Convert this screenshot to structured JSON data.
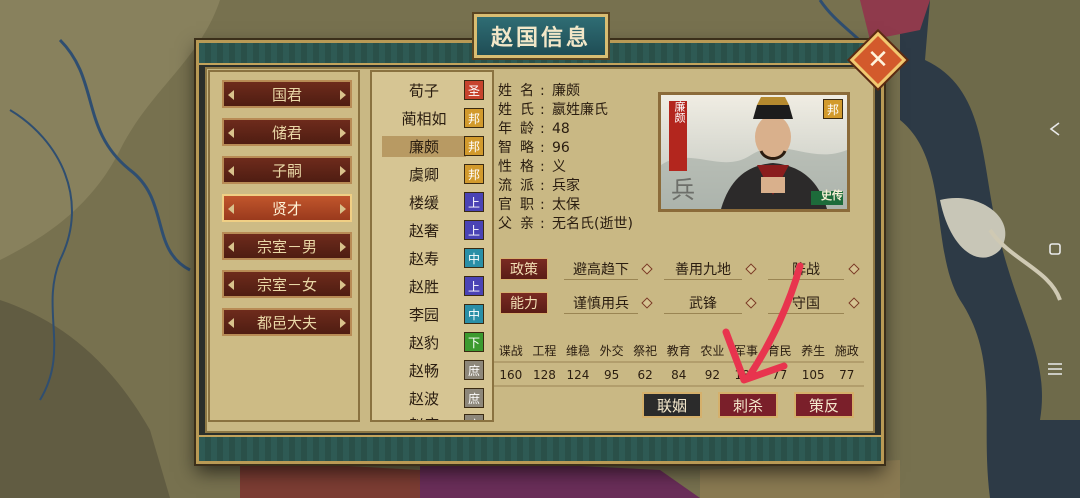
{
  "dialog": {
    "title": "赵国信息",
    "close_symbol": "✕"
  },
  "categories": [
    {
      "label": "国君",
      "active": false
    },
    {
      "label": "储君",
      "active": false
    },
    {
      "label": "子嗣",
      "active": false
    },
    {
      "label": "贤才",
      "active": true
    },
    {
      "label": "宗室－男",
      "active": false
    },
    {
      "label": "宗室－女",
      "active": false
    },
    {
      "label": "都邑大夫",
      "active": false
    }
  ],
  "persons": [
    {
      "name": "荀子",
      "tag": "圣",
      "tag_color": "#c7432d"
    },
    {
      "name": "蔺相如",
      "tag": "邦",
      "tag_color": "#d29a2c"
    },
    {
      "name": "廉颇",
      "tag": "邦",
      "tag_color": "#d29a2c",
      "selected": true
    },
    {
      "name": "虞卿",
      "tag": "邦",
      "tag_color": "#d29a2c"
    },
    {
      "name": "楼缓",
      "tag": "上",
      "tag_color": "#4a43b5"
    },
    {
      "name": "赵奢",
      "tag": "上",
      "tag_color": "#4a43b5"
    },
    {
      "name": "赵寿",
      "tag": "中",
      "tag_color": "#2a8fa7"
    },
    {
      "name": "赵胜",
      "tag": "上",
      "tag_color": "#4a43b5"
    },
    {
      "name": "李园",
      "tag": "中",
      "tag_color": "#2a8fa7"
    },
    {
      "name": "赵豹",
      "tag": "下",
      "tag_color": "#3c9a2f"
    },
    {
      "name": "赵畅",
      "tag": "庶",
      "tag_color": "#8d877a"
    },
    {
      "name": "赵波",
      "tag": "庶",
      "tag_color": "#8d877a"
    },
    {
      "name": "赵庶",
      "tag": "庶",
      "tag_color": "#8d877a"
    }
  ],
  "info": [
    {
      "key": "姓名",
      "value": "廉颇"
    },
    {
      "key": "姓氏",
      "value": "嬴姓廉氏"
    },
    {
      "key": "年龄",
      "value": "48"
    },
    {
      "key": "智略",
      "value": "96"
    },
    {
      "key": "性格",
      "value": "义"
    },
    {
      "key": "流派",
      "value": "兵家"
    },
    {
      "key": "官职",
      "value": "太保"
    },
    {
      "key": "父亲",
      "value": "无名氏(逝世)"
    }
  ],
  "portrait": {
    "side_name": "廉颇",
    "badge": "邦",
    "corner_char": "兵",
    "ribbon": "史传"
  },
  "skills": {
    "policy_label": "政策",
    "ability_label": "能力",
    "policy": [
      "避高趋下",
      "善用九地",
      "阵战"
    ],
    "ability": [
      "谨慎用兵",
      "武锋",
      "守国"
    ]
  },
  "stats": {
    "headers": [
      "谍战",
      "工程",
      "维稳",
      "外交",
      "祭祀",
      "教育",
      "农业",
      "军事",
      "育民",
      "养生",
      "施政"
    ],
    "values": [
      "160",
      "128",
      "124",
      "95",
      "62",
      "84",
      "92",
      "189",
      "77",
      "105",
      "77"
    ]
  },
  "actions": [
    {
      "label": "联姻",
      "color": "#2b2b2b"
    },
    {
      "label": "刺杀",
      "color": "#7a1f2a"
    },
    {
      "label": "策反",
      "color": "#7a1f2a"
    }
  ],
  "colors": {
    "accent_red": "#e8344e",
    "panel": "#c9b884",
    "frame_gold": "#b99a55"
  }
}
